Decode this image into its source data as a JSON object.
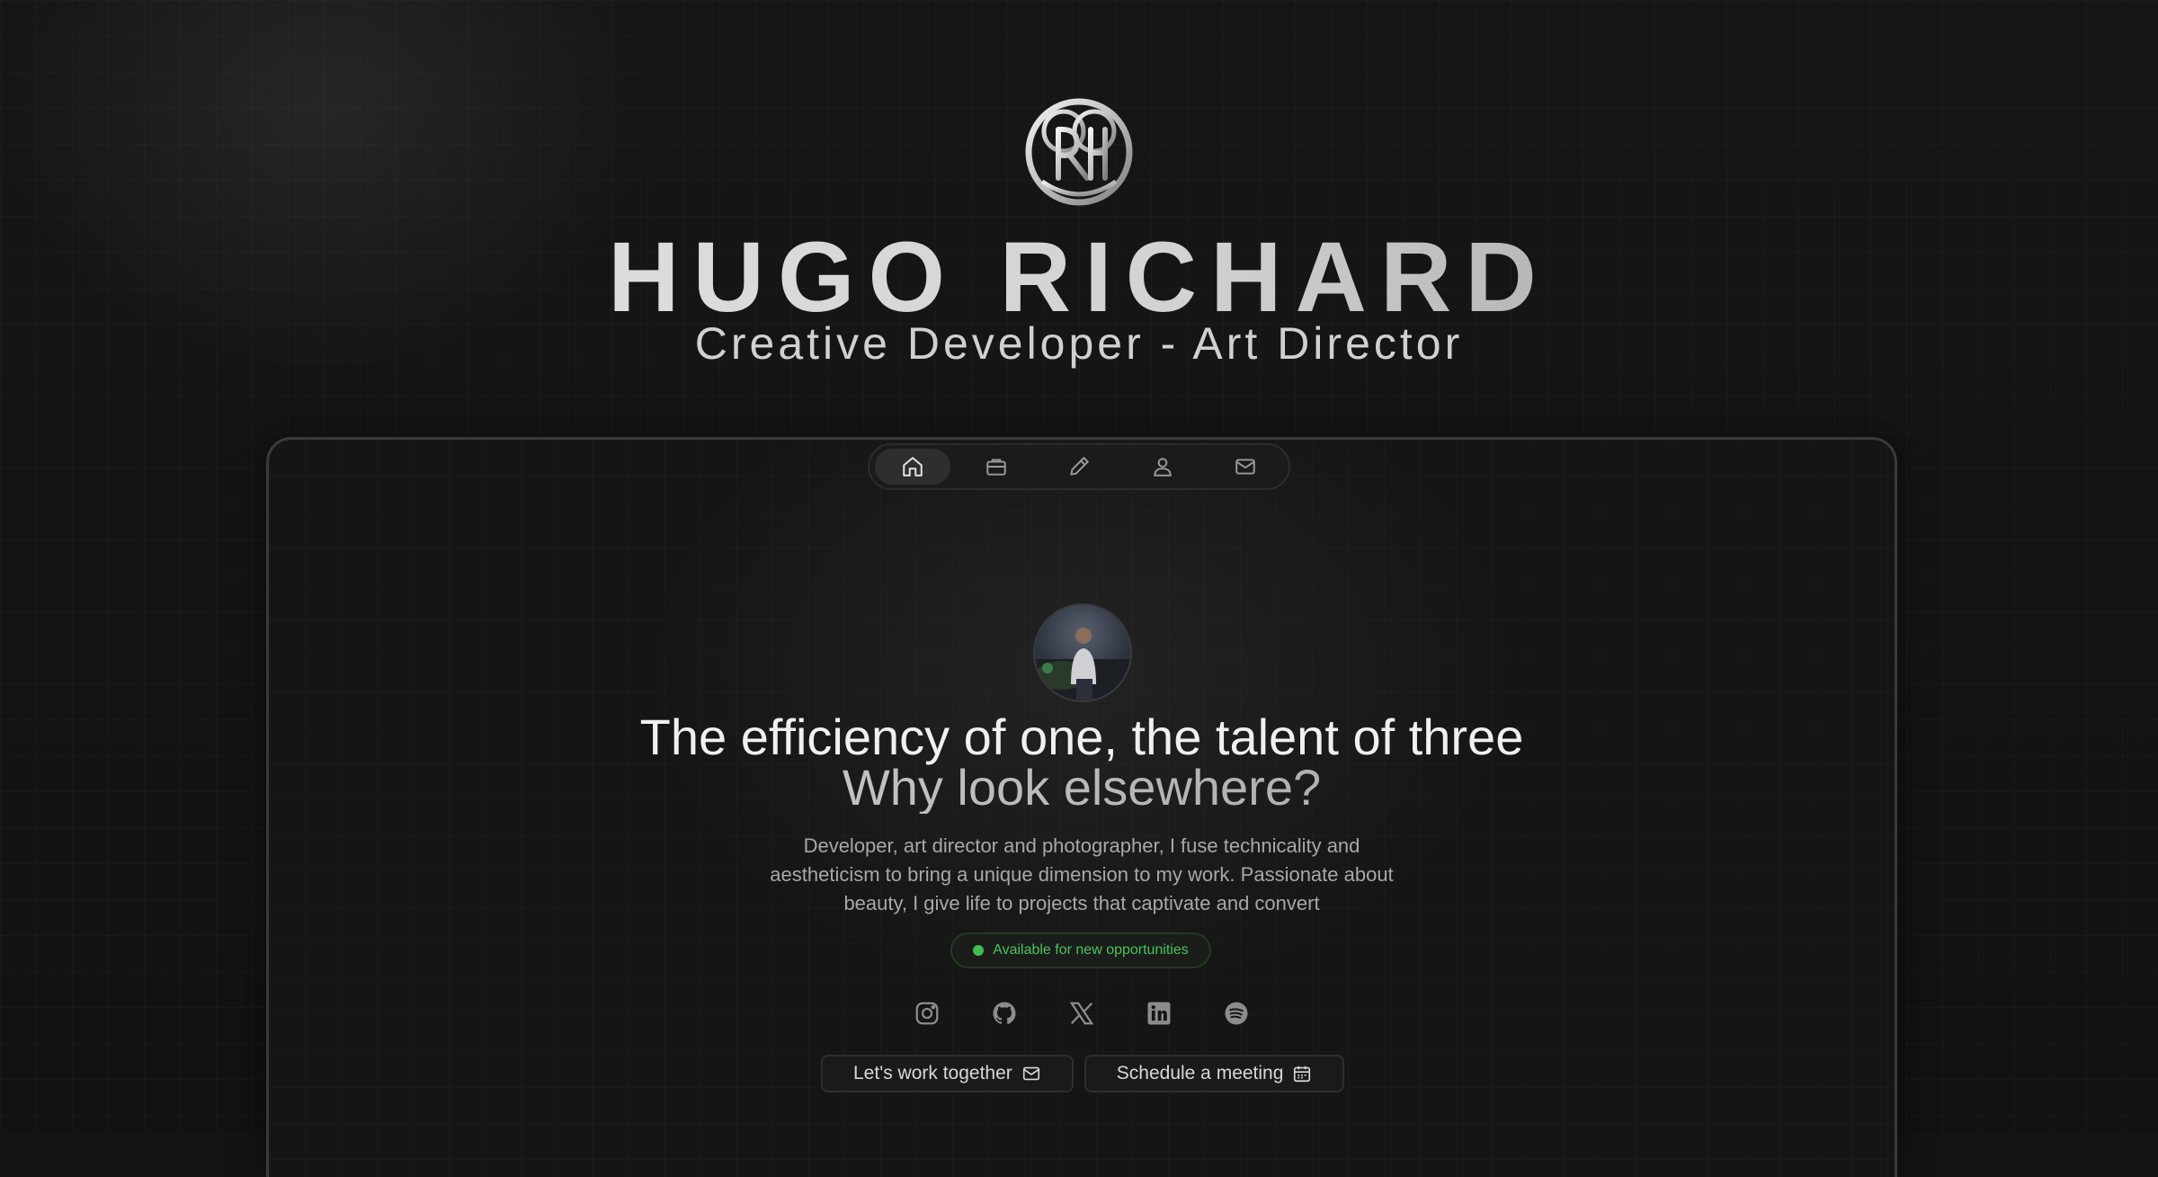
{
  "hero": {
    "name": "HUGO RICHARD",
    "subtitle": "Creative Developer - Art Director"
  },
  "nav": {
    "items": [
      {
        "icon": "home-icon",
        "active": true
      },
      {
        "icon": "briefcase-icon",
        "active": false
      },
      {
        "icon": "pen-icon",
        "active": false
      },
      {
        "icon": "user-icon",
        "active": false
      },
      {
        "icon": "mail-icon",
        "active": false
      }
    ]
  },
  "profile": {
    "headline": "The efficiency of one, the talent of three",
    "headline_2": "Why look elsewhere?",
    "description": "Developer, art director and photographer, I fuse technicality and aestheticism to bring a unique dimension to my work. Passionate about beauty, I give life to projects that captivate and convert",
    "status": "Available for new opportunities",
    "status_color": "#3fbf4f"
  },
  "socials": [
    "instagram-icon",
    "github-icon",
    "x-icon",
    "linkedin-icon",
    "spotify-icon"
  ],
  "ctas": {
    "work_label": "Let's work together",
    "meeting_label": "Schedule a meeting"
  }
}
